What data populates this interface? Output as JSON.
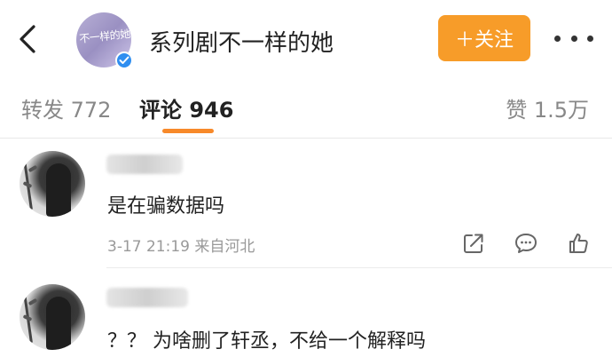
{
  "header": {
    "title": "系列剧不一样的她",
    "avatar_logo_text": "不一样的她",
    "follow_label": "＋关注",
    "icons": [
      "back-arrow-icon",
      "verified-badge-icon",
      "more-icon"
    ]
  },
  "tabs": {
    "repost": "转发 772",
    "comment": "评论 946",
    "like": "赞 1.5万",
    "active": "comment",
    "accent_color": "#f7892a"
  },
  "comments": [
    {
      "username": "",
      "text": "是在骗数据吗",
      "time_location": "3-17 21:19 来自河北",
      "actions": [
        "share-icon",
        "comment-icon",
        "like-icon"
      ]
    },
    {
      "username": "",
      "text": "？？ 为啥删了轩丞，不给一个解释吗"
    }
  ],
  "colors": {
    "follow_button": "#f79c29",
    "verified_badge": "#2f8ef0"
  }
}
